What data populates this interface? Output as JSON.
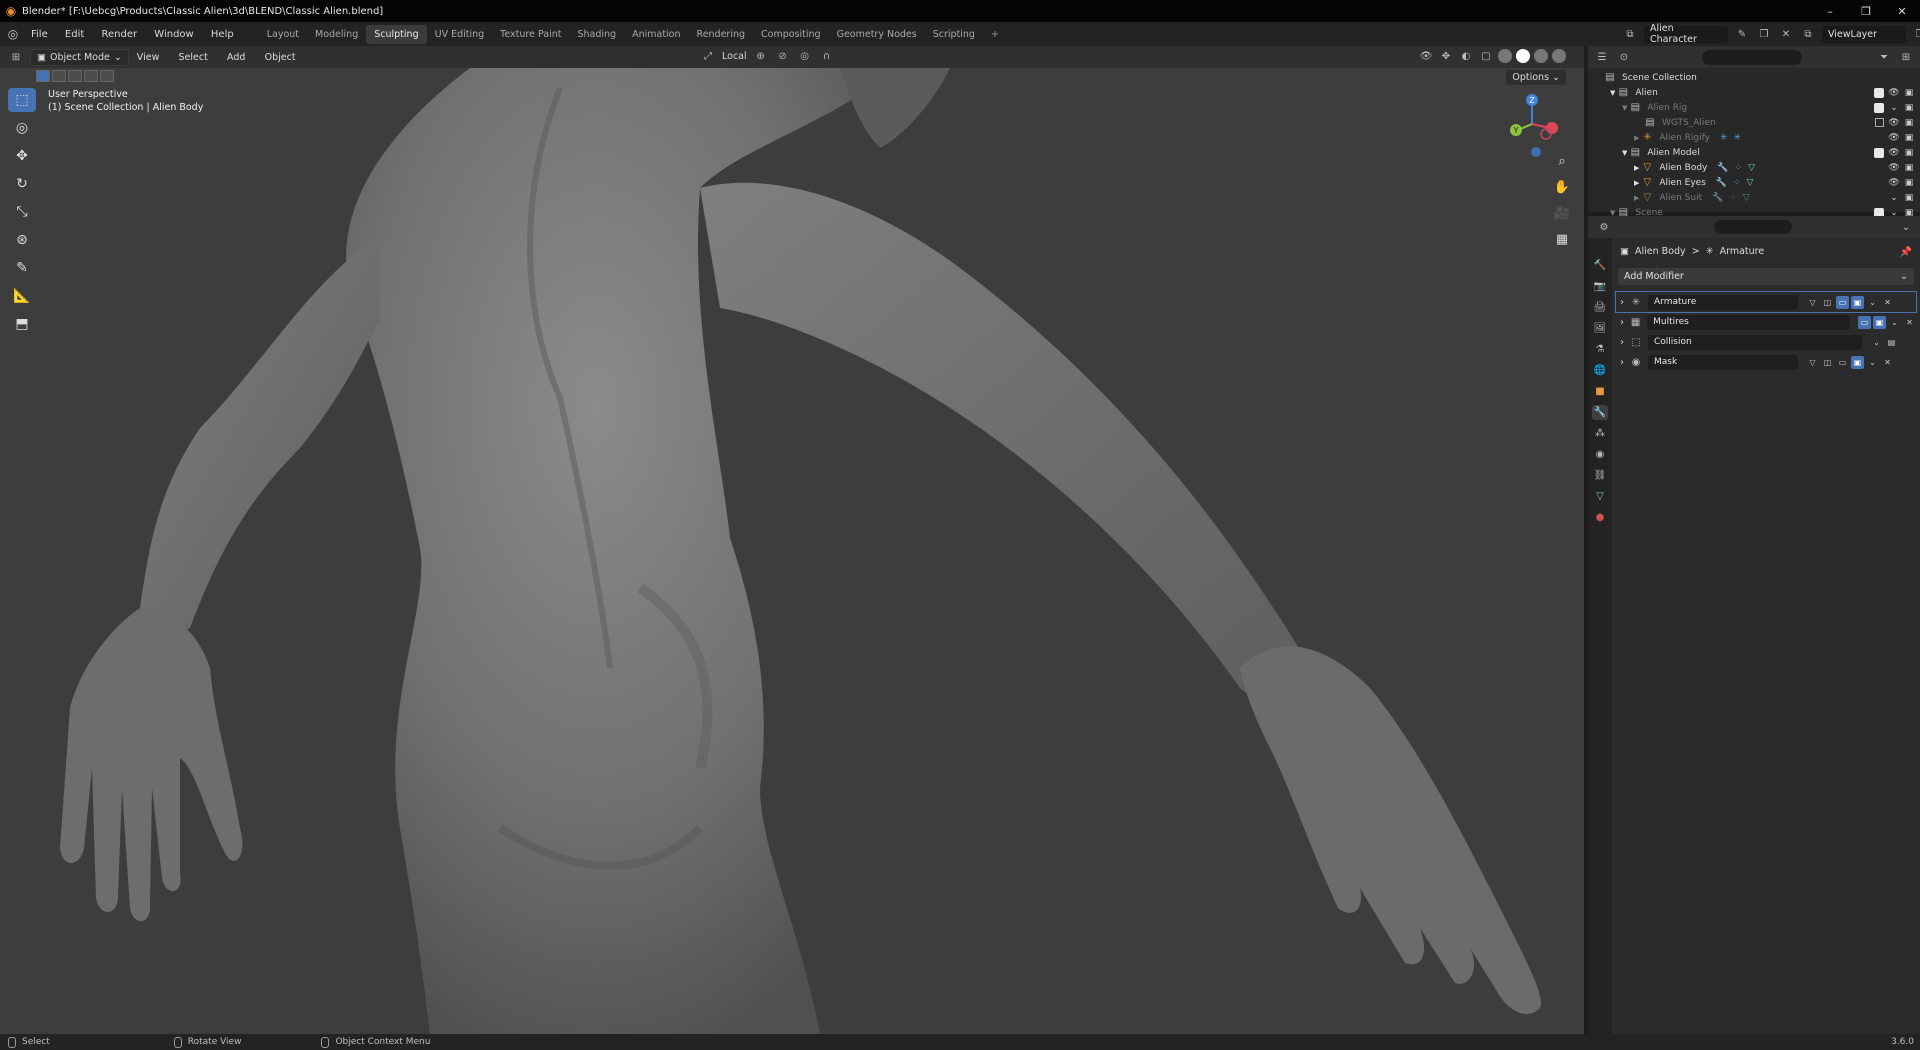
{
  "window": {
    "title": "Blender* [F:\\Uebcg\\Products\\Classic Alien\\3d\\BLEND\\Classic Alien.blend]",
    "controls": [
      "–",
      "❐",
      "✕"
    ]
  },
  "menu": [
    "File",
    "Edit",
    "Render",
    "Window",
    "Help"
  ],
  "workspaces": {
    "tabs": [
      "Layout",
      "Modeling",
      "Sculpting",
      "UV Editing",
      "Texture Paint",
      "Shading",
      "Animation",
      "Rendering",
      "Compositing",
      "Geometry Nodes",
      "Scripting"
    ],
    "active": "Sculpting",
    "add": "+"
  },
  "scene": {
    "name": "Alien Character",
    "view_layer": "ViewLayer"
  },
  "viewport_header": {
    "mode": "Object Mode",
    "menus": [
      "View",
      "Select",
      "Add",
      "Object"
    ],
    "orientation": "Local"
  },
  "viewport": {
    "perspective": "User Perspective",
    "collection_info": "(1) Scene Collection | Alien Body",
    "options": "Options",
    "gizmo": {
      "z": "Z",
      "y": "Y",
      "x": "X"
    }
  },
  "outliner": {
    "rows": [
      {
        "label": "Scene Collection",
        "level": 0,
        "dim": false
      },
      {
        "label": "Alien",
        "level": 1,
        "dim": false
      },
      {
        "label": "Alien Rig",
        "level": 2,
        "dim": true
      },
      {
        "label": "WGTS_Alien",
        "level": 3,
        "dim": true
      },
      {
        "label": "Alien Rigify",
        "level": 3,
        "dim": true
      },
      {
        "label": "Alien Model",
        "level": 2,
        "dim": false
      },
      {
        "label": "Alien Body",
        "level": 3,
        "dim": false
      },
      {
        "label": "Alien Eyes",
        "level": 3,
        "dim": false
      },
      {
        "label": "Alien Suit",
        "level": 3,
        "dim": true
      },
      {
        "label": "Scene",
        "level": 1,
        "dim": true
      }
    ]
  },
  "properties": {
    "breadcrumb": {
      "object": "Alien Body",
      "separator": ">",
      "data": "Armature"
    },
    "add_modifier": "Add Modifier",
    "modifiers": [
      {
        "name": "Armature",
        "selected": true
      },
      {
        "name": "Multires",
        "selected": false
      },
      {
        "name": "Collision",
        "selected": false
      },
      {
        "name": "Mask",
        "selected": false
      }
    ]
  },
  "statusbar": {
    "select": "Select",
    "rotate": "Rotate View",
    "context": "Object Context Menu",
    "version": "3.6.0"
  },
  "colors": {
    "accent": "#4772b3",
    "viewport_bg": "#3d3d3d",
    "mesh": "#7d7f7d",
    "axis_x": "#e0455a",
    "axis_y": "#8bc43f",
    "axis_z": "#3f84d9"
  }
}
